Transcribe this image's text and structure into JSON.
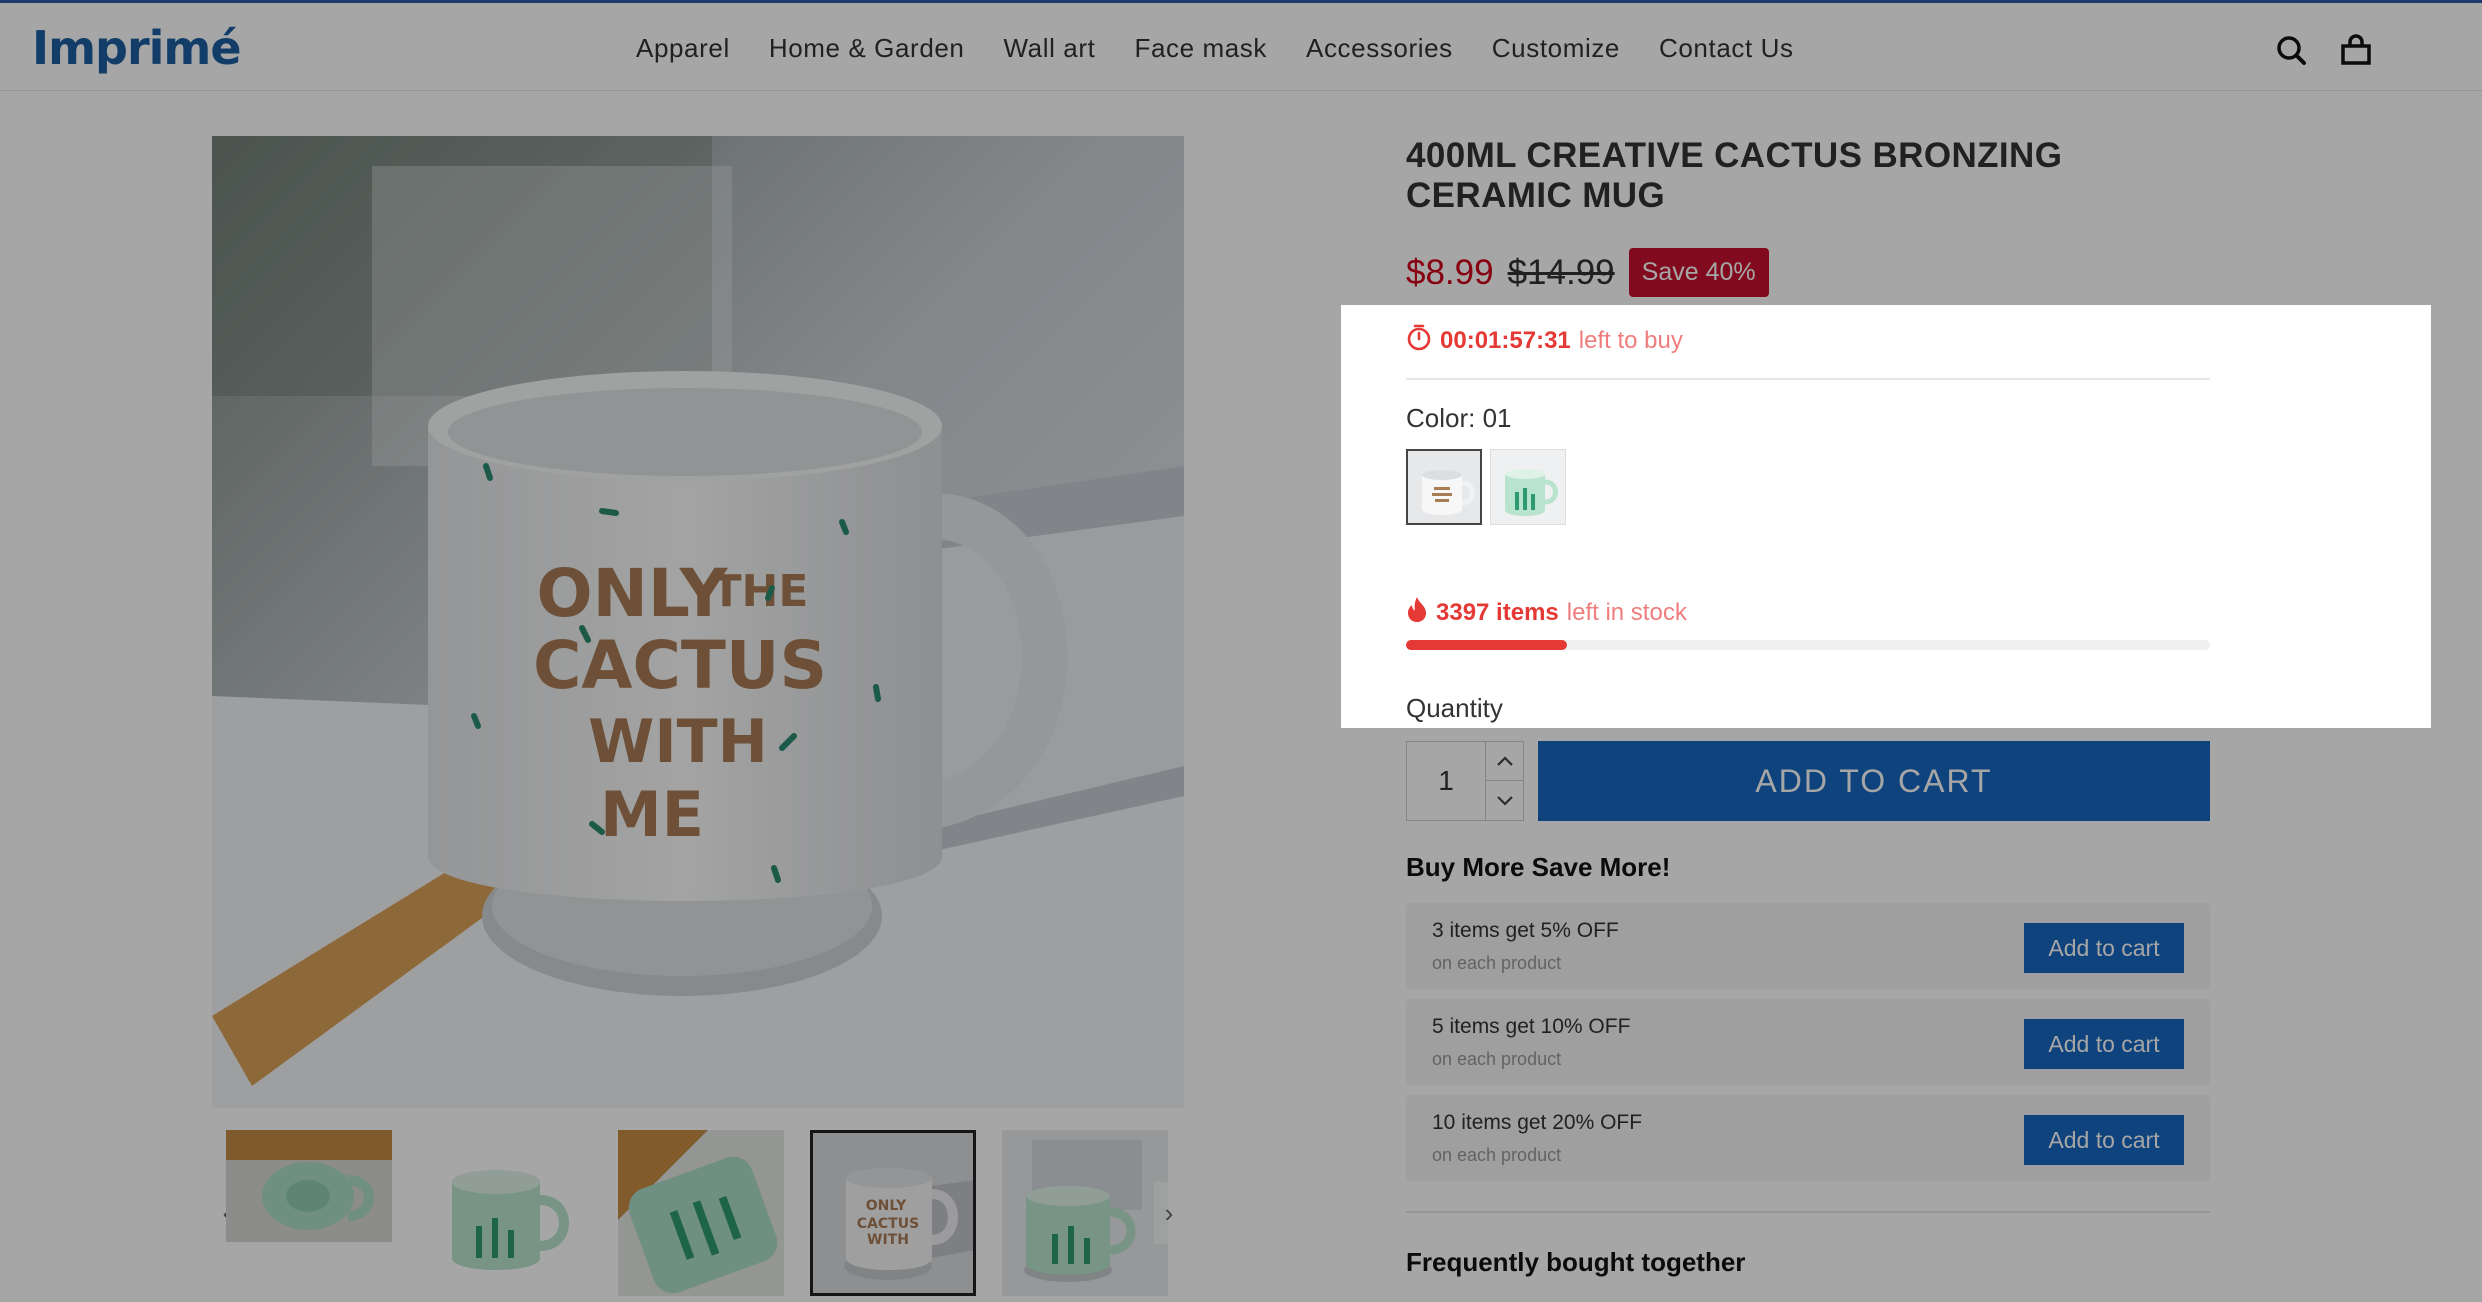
{
  "header": {
    "logo": "Imprimé",
    "nav": [
      "Apparel",
      "Home & Garden",
      "Wall art",
      "Face mask",
      "Accessories",
      "Customize",
      "Contact Us"
    ]
  },
  "product": {
    "title": "400ML CREATIVE CACTUS BRONZING CERAMIC MUG",
    "price": "$8.99",
    "compare_price": "$14.99",
    "save_badge": "Save 40%",
    "timer_value": "00:01:57:31",
    "timer_suffix": "left to buy",
    "color_label": "Color: 01",
    "stock_count": "3397 items",
    "stock_suffix": "left in stock",
    "stock_fraction": 0.2,
    "quantity_label": "Quantity",
    "quantity_value": "1",
    "add_to_cart": "ADD TO CART",
    "mug_text": [
      "ONLY",
      "THE",
      "CACTUS",
      "WITH",
      "ME"
    ]
  },
  "buy_more": {
    "title": "Buy More Save More!",
    "items": [
      {
        "main": "3 items get 5% OFF",
        "sub": "on each product",
        "button": "Add to cart"
      },
      {
        "main": "5 items get 10% OFF",
        "sub": "on each product",
        "button": "Add to cart"
      },
      {
        "main": "10 items get 20% OFF",
        "sub": "on each product",
        "button": "Add to cart"
      }
    ]
  },
  "frequently_bought": "Frequently bought together",
  "colors": {
    "brand": "#1d5fa0",
    "button": "#1867c0",
    "sale": "#d0021b",
    "badge": "#c8102e",
    "alert": "#e53935"
  }
}
